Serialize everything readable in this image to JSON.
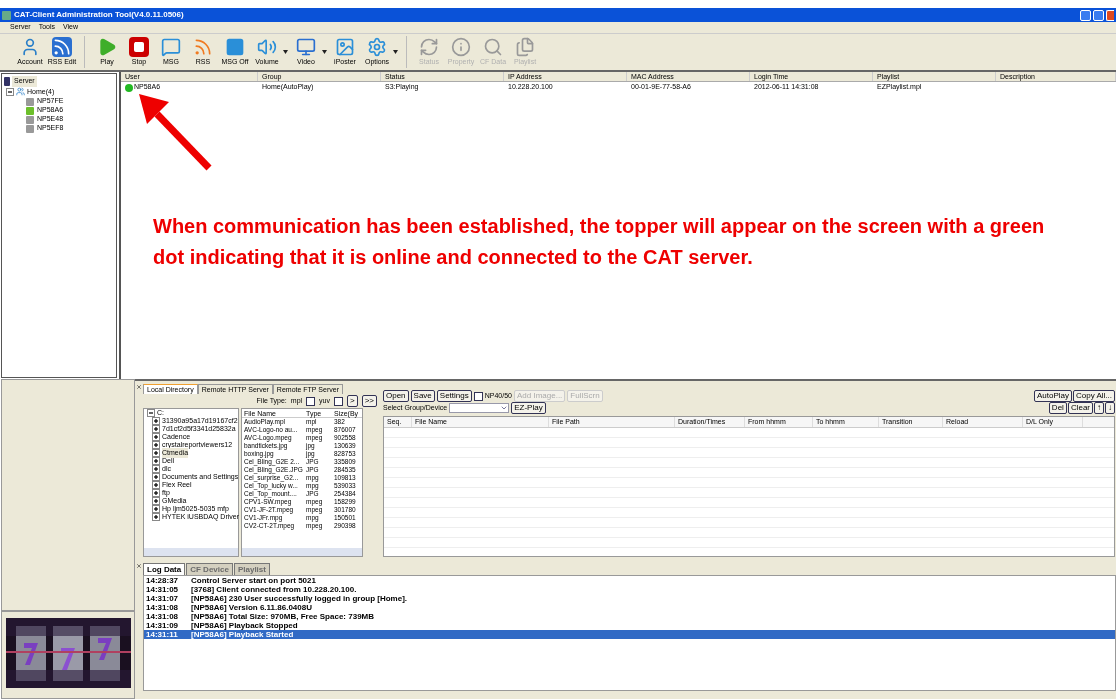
{
  "window": {
    "title": "CAT-Client Administration Tool(V4.0.11.0506)"
  },
  "menu": [
    "Server",
    "Tools",
    "View"
  ],
  "toolbar_groups": [
    [
      {
        "label": "Account",
        "disabled": false,
        "has_menu": false
      },
      {
        "label": "RSS Edit",
        "disabled": false,
        "has_menu": false
      }
    ],
    [
      {
        "label": "Play",
        "disabled": false,
        "has_menu": false
      },
      {
        "label": "Stop",
        "disabled": false,
        "has_menu": false
      },
      {
        "label": "MSG",
        "disabled": false,
        "has_menu": false
      },
      {
        "label": "RSS",
        "disabled": false,
        "has_menu": false
      },
      {
        "label": "MSG Off",
        "disabled": false,
        "has_menu": false
      },
      {
        "label": "Volume",
        "disabled": false,
        "has_menu": true
      },
      {
        "label": "Video",
        "disabled": false,
        "has_menu": true
      },
      {
        "label": "iPoster",
        "disabled": false,
        "has_menu": false
      },
      {
        "label": "Options",
        "disabled": false,
        "has_menu": true
      }
    ],
    [
      {
        "label": "Status",
        "disabled": true,
        "has_menu": false
      },
      {
        "label": "Property",
        "disabled": true,
        "has_menu": false
      },
      {
        "label": "CF Data",
        "disabled": true,
        "has_menu": false
      },
      {
        "label": "Playlist",
        "disabled": true,
        "has_menu": false
      }
    ]
  ],
  "tree": {
    "label": "Server",
    "selected": true,
    "children": [
      {
        "label": "Home(4)",
        "expanded": true,
        "children": [
          {
            "label": "NP57FE",
            "online": false
          },
          {
            "label": "NP58A6",
            "online": true
          },
          {
            "label": "NP5E48",
            "online": false
          },
          {
            "label": "NP5EF8",
            "online": false
          }
        ]
      }
    ]
  },
  "clients_table": {
    "columns": [
      "User",
      "Group",
      "Status",
      "IP Address",
      "MAC Address",
      "Login Time",
      "Playlist",
      "Description"
    ],
    "rows": [
      {
        "online": true,
        "cells": [
          "NP58A6",
          "Home(AutoPlay)",
          "S3:Playing",
          "10.228.20.100",
          "00-01-9E-77-58-A6",
          "2012-06-11 14:31:08",
          "EZPlaylist.mpl"
        ]
      }
    ]
  },
  "annotation": {
    "text": "When communication has been established, the topper will appear on the screen with a green dot indicating that it is online and connected to the CAT server."
  },
  "source_tabs": [
    {
      "label": "Local Directory",
      "selected": true
    },
    {
      "label": "Remote HTTP Server",
      "selected": false
    },
    {
      "label": "Remote FTP Server",
      "selected": false
    }
  ],
  "file_type": {
    "label": "File Type:",
    "options": [
      {
        "label": "mpl",
        "checked": false
      },
      {
        "label": "yuv",
        "checked": false
      }
    ],
    "buttons": [
      ">",
      ">>"
    ]
  },
  "directory_tree": {
    "root": "C:",
    "children": [
      {
        "label": "31390a95a17d19167cf2",
        "selected": false
      },
      {
        "label": "7d1cf2d5f3341d25832a",
        "selected": false
      },
      {
        "label": "Cadence",
        "selected": false
      },
      {
        "label": "crystalreportviewers12",
        "selected": false
      },
      {
        "label": "Ctmedia",
        "selected": true
      },
      {
        "label": "Dell",
        "selected": false
      },
      {
        "label": "dlc",
        "selected": false
      },
      {
        "label": "Documents and Settings",
        "selected": false
      },
      {
        "label": "Flex Reel",
        "selected": false
      },
      {
        "label": "ftp",
        "selected": false
      },
      {
        "label": "GMedia",
        "selected": false
      },
      {
        "label": "Hp ljm5025-5035 mfp",
        "selected": false
      },
      {
        "label": "HYTEK iUSBDAQ Driver",
        "selected": false
      }
    ]
  },
  "files": {
    "columns": [
      "File Name",
      "Type",
      "Size(By"
    ],
    "rows": [
      [
        "AudioPlay.mpl",
        "mpl",
        "382"
      ],
      [
        "AVC-Logo-no au...",
        "mpeg",
        "876007"
      ],
      [
        "AVC-Logo.mpeg",
        "mpeg",
        "902558"
      ],
      [
        "bandtickets.jpg",
        "jpg",
        "130639"
      ],
      [
        "boxing.jpg",
        "jpg",
        "828753"
      ],
      [
        "Cel_Bling_G2E 2...",
        "JPG",
        "335809"
      ],
      [
        "Cel_Bling_G2E.JPG",
        "JPG",
        "284535"
      ],
      [
        "Cel_surprise_G2...",
        "mpg",
        "109813"
      ],
      [
        "Cel_Top_lucky w...",
        "mpg",
        "539033"
      ],
      [
        "Cel_Top_mount....",
        "JPG",
        "254384"
      ],
      [
        "CPV1-SW.mpeg",
        "mpeg",
        "158299"
      ],
      [
        "CV1-JF-2T.mpeg",
        "mpeg",
        "301780"
      ],
      [
        "CV1-JFr.mpg",
        "mpg",
        "150501"
      ],
      [
        "CV2-CT-2T.mpeg",
        "mpeg",
        "290398"
      ]
    ]
  },
  "playlist_toolbar": {
    "buttons": [
      {
        "label": "Open",
        "disabled": false
      },
      {
        "label": "Save",
        "disabled": false
      },
      {
        "label": "Settings",
        "disabled": false
      }
    ],
    "checkbox": {
      "label": "NP40/50",
      "checked": false
    },
    "more_buttons": [
      {
        "label": "Add Image...",
        "disabled": true
      },
      {
        "label": "FullScrn",
        "disabled": true
      }
    ],
    "right_buttons": [
      "AutoPlay",
      "Copy All..."
    ],
    "select_label": "Select Group/Device",
    "ez_play": "EZ-Play",
    "edit_buttons": [
      "Del",
      "Clear",
      "↑",
      "↓"
    ]
  },
  "playlist_table": {
    "columns": [
      "Seq.",
      "File Name",
      "File Path",
      "Duration/Times",
      "From hhmm",
      "To hhmm",
      "Transition",
      "Reload",
      "D/L Only"
    ]
  },
  "log_tabs": [
    {
      "label": "Log Data",
      "selected": true
    },
    {
      "label": "CF Device",
      "selected": false
    },
    {
      "label": "Playlist",
      "selected": false
    }
  ],
  "log": [
    {
      "time": "14:28:37",
      "message": "Control Server start on port 5021",
      "selected": false
    },
    {
      "time": "14:31:05",
      "message": "[3768] Client connected from 10.228.20.100.",
      "selected": false
    },
    {
      "time": "14:31:07",
      "message": "[NP58A6] 230 User successfully logged in group [Home].",
      "selected": false
    },
    {
      "time": "14:31:08",
      "message": "[NP58A6] Version 6.11.86.0408U",
      "selected": false
    },
    {
      "time": "14:31:08",
      "message": "[NP58A6] Total Size: 970MB, Free Space: 739MB",
      "selected": false
    },
    {
      "time": "14:31:09",
      "message": "[NP58A6] Playback Stopped",
      "selected": false
    },
    {
      "time": "14:31:11",
      "message": "[NP58A6] Playback Started",
      "selected": true
    }
  ],
  "banner": {
    "kind": "picture"
  }
}
